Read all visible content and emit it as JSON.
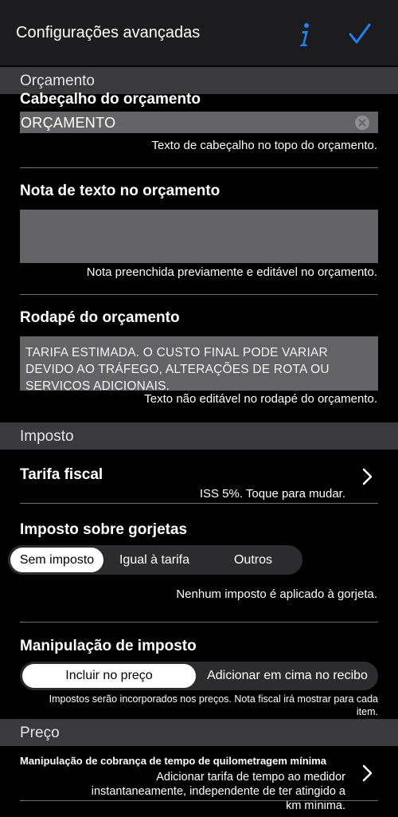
{
  "navbar": {
    "title": "Configurações avançadas",
    "info_icon": "info-icon",
    "confirm_icon": "checkmark-icon",
    "accent": "#1e82f0"
  },
  "sections": {
    "budget": "Orçamento",
    "tax": "Imposto",
    "price": "Preço"
  },
  "budget_header": {
    "label": "Cabeçalho do orçamento",
    "value": "ORÇAMENTO",
    "helper": "Texto de cabeçalho no topo do orçamento."
  },
  "budget_note": {
    "label": "Nota de texto no orçamento",
    "value": "",
    "helper": "Nota preenchida previamente e editável no orçamento."
  },
  "budget_footer": {
    "label": "Rodapé do orçamento",
    "value": "TARIFA ESTIMADA. O CUSTO FINAL PODE VARIAR DEVIDO AO TRÁFEGO, ALTERAÇÕES DE ROTA OU SERVIÇOS ADICIONAIS.",
    "helper": "Texto não editável no rodapé do orçamento."
  },
  "tax_rate": {
    "label": "Tarifa fiscal",
    "detail": "ISS 5%. Toque para mudar."
  },
  "tip_tax": {
    "label": "Imposto sobre gorjetas",
    "options": [
      "Sem imposto",
      "Igual à tarifa",
      "Outros"
    ],
    "selected": "Sem imposto",
    "helper": "Nenhum imposto é aplicado à gorjeta."
  },
  "tax_handling": {
    "label": "Manipulação de imposto",
    "options": [
      "Incluir no preço",
      "Adicionar em cima no recibo"
    ],
    "selected": "Incluir no preço",
    "helper": "Impostos serão incorporados nos preços. Nota fiscal irá mostrar para cada item."
  },
  "min_km_time": {
    "label": "Manipulação de cobrança de tempo de quilometragem mínima",
    "detail": "Adicionar tarifa de tempo ao medidor instantaneamente, independente de ter atingido a km mínima."
  }
}
